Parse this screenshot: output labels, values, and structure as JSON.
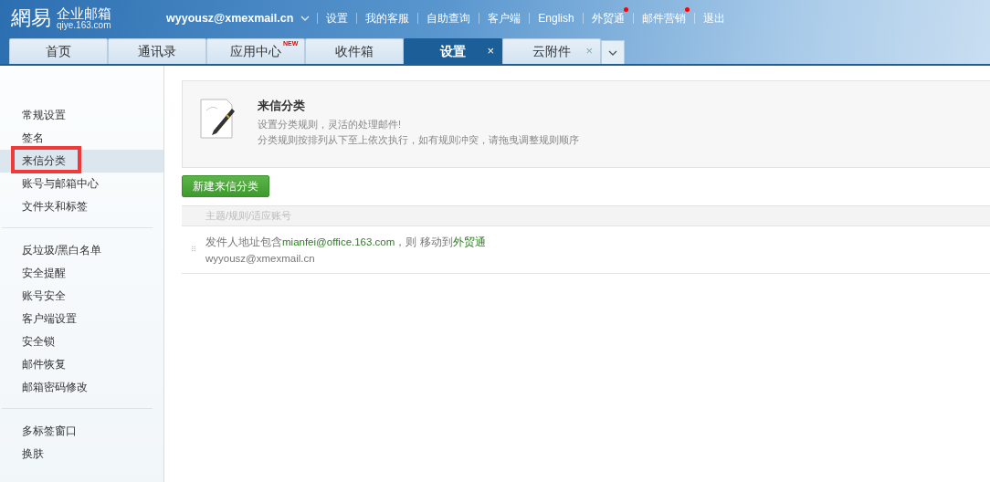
{
  "logo": {
    "mark": "網易",
    "product": "企业邮箱",
    "domain": "qiye.163.com"
  },
  "account": {
    "email": "wyyousz@xmexmail.cn"
  },
  "nav_links": [
    {
      "label": "设置",
      "dot": false
    },
    {
      "label": "我的客服",
      "dot": false
    },
    {
      "label": "自助查询",
      "dot": false
    },
    {
      "label": "客户端",
      "dot": false
    },
    {
      "label": "English",
      "dot": false
    },
    {
      "label": "外贸通",
      "dot": true
    },
    {
      "label": "邮件营销",
      "dot": true
    },
    {
      "label": "退出",
      "dot": false
    }
  ],
  "tabs": [
    {
      "label": "首页",
      "selected": false
    },
    {
      "label": "通讯录",
      "selected": false
    },
    {
      "label": "应用中心",
      "selected": false,
      "badge": "NEW"
    },
    {
      "label": "收件箱",
      "selected": false
    },
    {
      "label": "设置",
      "selected": true,
      "close": "×"
    },
    {
      "label": "云附件",
      "selected": false,
      "close": "×"
    }
  ],
  "sidebar": {
    "groups": [
      {
        "items": [
          {
            "label": "常规设置",
            "selected": false,
            "annotated": false
          },
          {
            "label": "签名",
            "selected": false,
            "annotated": false
          },
          {
            "label": "来信分类",
            "selected": true,
            "annotated": true
          },
          {
            "label": "账号与邮箱中心",
            "selected": false,
            "annotated": false
          },
          {
            "label": "文件夹和标签",
            "selected": false,
            "annotated": false
          }
        ]
      },
      {
        "items": [
          {
            "label": "反垃圾/黑白名单",
            "selected": false,
            "annotated": false
          },
          {
            "label": "安全提醒",
            "selected": false,
            "annotated": false
          },
          {
            "label": "账号安全",
            "selected": false,
            "annotated": false
          },
          {
            "label": "客户端设置",
            "selected": false,
            "annotated": false
          },
          {
            "label": "安全锁",
            "selected": false,
            "annotated": false
          },
          {
            "label": "邮件恢复",
            "selected": false,
            "annotated": false
          },
          {
            "label": "邮箱密码修改",
            "selected": false,
            "annotated": false
          }
        ]
      },
      {
        "items": [
          {
            "label": "多标签窗口",
            "selected": false,
            "annotated": false
          },
          {
            "label": "换肤",
            "selected": false,
            "annotated": false
          }
        ]
      }
    ]
  },
  "intro": {
    "title": "来信分类",
    "lines": [
      "设置分类规则，灵活的处理邮件!",
      "分类规则按排列从下至上依次执行，如有规则冲突，请拖曳调整规则顺序"
    ]
  },
  "new_button": "新建来信分类",
  "table": {
    "columns": [
      "主题/规则/适应账号"
    ],
    "rows": [
      {
        "handle": "⠿",
        "rule": [
          {
            "text": "发件人地址包含",
            "highlight": false
          },
          {
            "text": "mianfei@office.163.com",
            "highlight": true
          },
          {
            "text": "，则 移动到",
            "highlight": false
          },
          {
            "text": "外贸通",
            "highlight": true
          }
        ],
        "account": "wyyousz@xmexmail.cn"
      }
    ]
  }
}
